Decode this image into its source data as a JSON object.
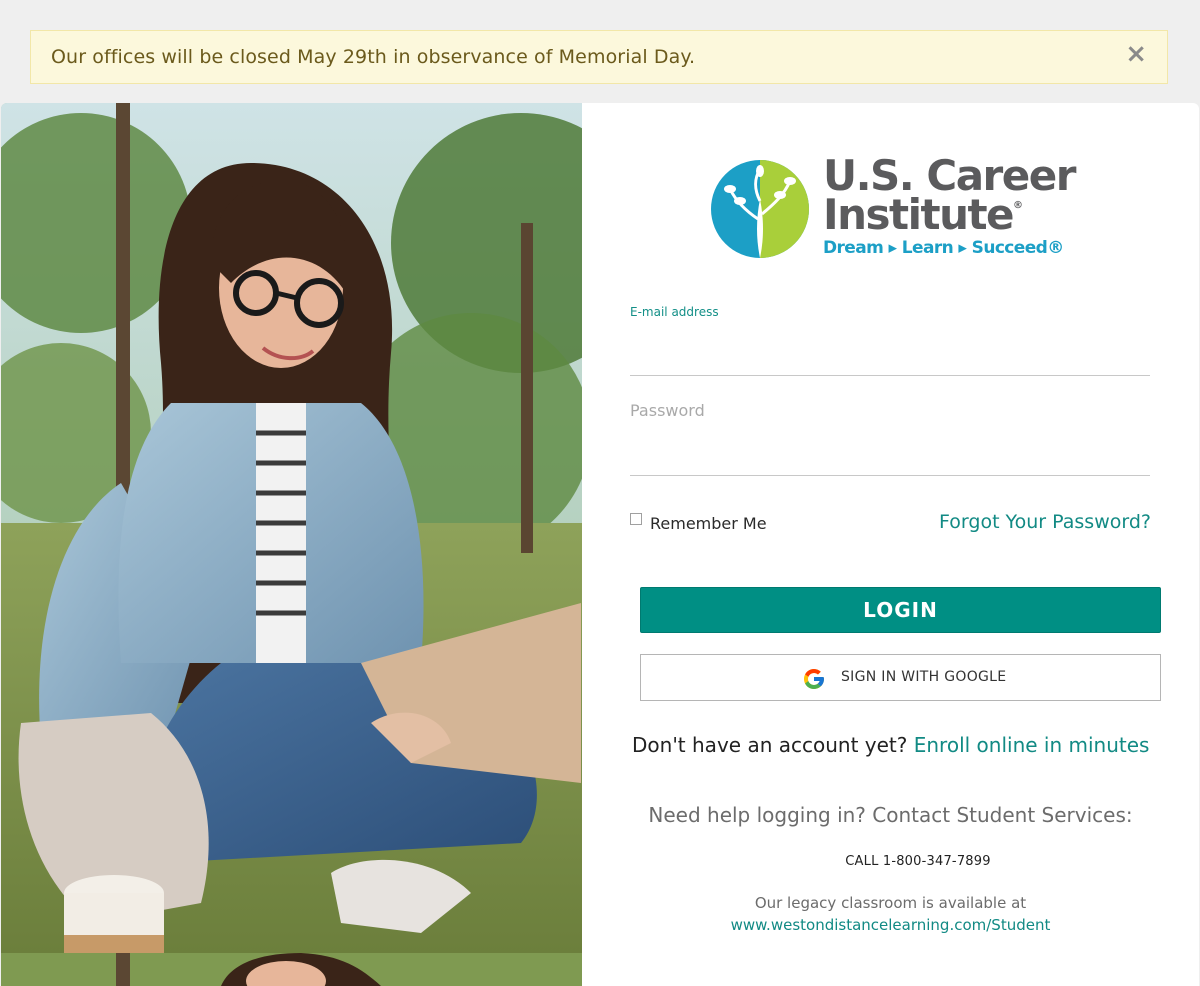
{
  "alert": {
    "message": "Our offices will be closed May 29th in observance of Memorial Day.",
    "close_glyph": "×"
  },
  "logo": {
    "line1": "U.S. Career",
    "line2": "Institute",
    "registered": "®",
    "tagline": "Dream ▸ Learn ▸ Succeed®",
    "colors": {
      "teal": "#1c9fc6",
      "green": "#a9cf3a",
      "gray": "#5b5b5d"
    }
  },
  "form": {
    "email_label": "E-mail address",
    "email_value": "",
    "password_label": "Password",
    "password_value": "",
    "remember_label": "Remember Me",
    "remember_checked": false,
    "forgot_label": "Forgot Your Password?",
    "login_label": "LOGIN",
    "google_label": "SIGN IN WITH GOOGLE"
  },
  "footer": {
    "no_account": "Don't have an account yet?",
    "enroll_link": "Enroll online in minutes",
    "help_text": "Need help logging in? Contact Student Services:",
    "call_text": "CALL 1-800-347-7899",
    "legacy_text": "Our legacy classroom is available at",
    "legacy_link": "www.westondistancelearning.com/Student"
  },
  "colors": {
    "accent": "#008f84",
    "link": "#128a84",
    "alert_bg": "#fcf8dc"
  }
}
